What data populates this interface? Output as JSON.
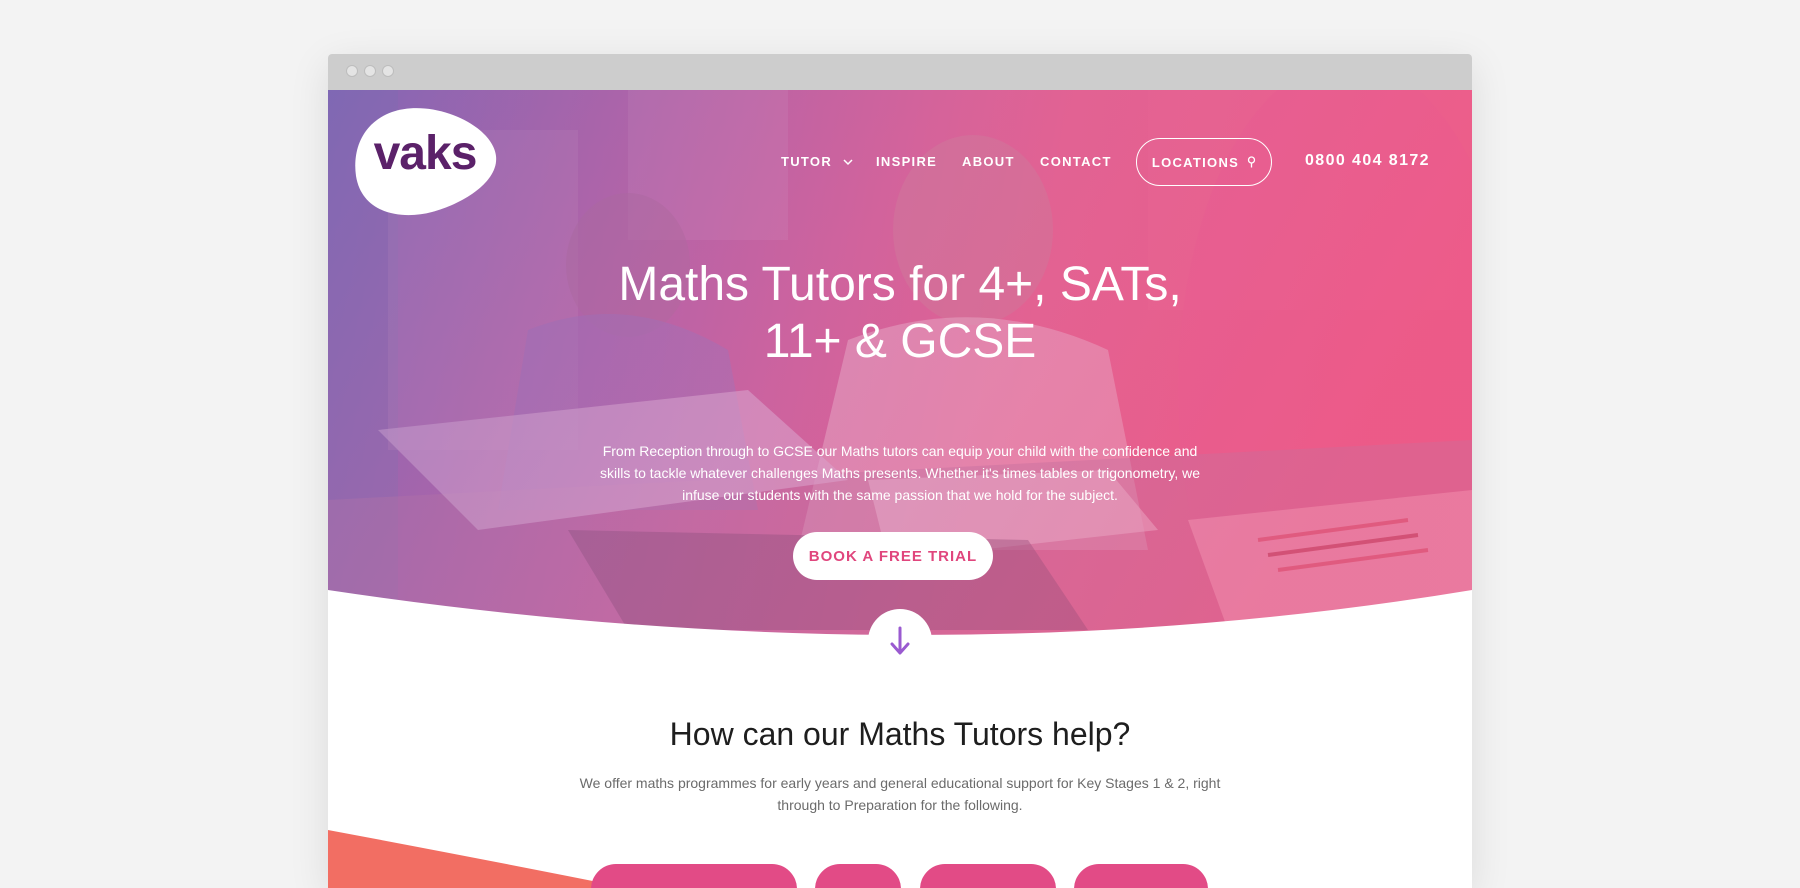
{
  "brand": {
    "logo_text": "vaks",
    "primary": "#e24b86",
    "logo_purple": "#5b2169",
    "accent_purple": "#9a5ad0",
    "coral": "#f26e63"
  },
  "nav": {
    "tutor_label": "TUTOR",
    "inspire_label": "INSPIRE",
    "about_label": "ABOUT",
    "contact_label": "CONTACT",
    "locations_label": "LOCATIONS",
    "phone": "0800 404 8172"
  },
  "hero": {
    "title_line1": "Maths Tutors for 4+, SATs,",
    "title_line2": "11+ & GCSE",
    "subtitle": "From Reception through to GCSE our Maths tutors can equip your child with the confidence and skills to tackle whatever challenges Maths presents. Whether it's times tables or trigonometry, we infuse our students with the same passion that we hold for the subject.",
    "cta_label": "BOOK A FREE TRIAL"
  },
  "section2": {
    "title": "How can our Maths Tutors help?",
    "text": "We offer maths programmes for early years and general educational support for Key Stages 1 & 2, right through to Preparation for the following."
  },
  "icons": [
    "chevron-down-icon",
    "map-pin-icon",
    "arrow-down-icon"
  ]
}
